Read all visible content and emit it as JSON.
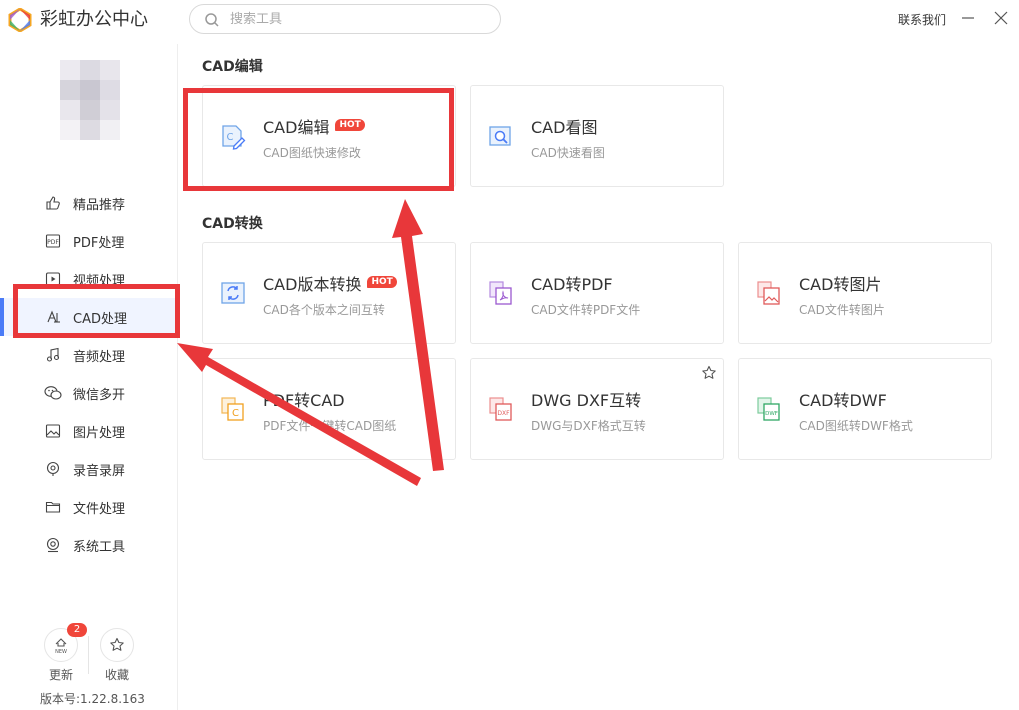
{
  "app": {
    "title": "彩虹办公中心",
    "contact_label": "联系我们",
    "search_placeholder": "搜索工具"
  },
  "sidebar": {
    "items": [
      {
        "label": "精品推荐",
        "icon": "thumbs-up-icon"
      },
      {
        "label": "PDF处理",
        "icon": "pdf-icon"
      },
      {
        "label": "视频处理",
        "icon": "video-icon"
      },
      {
        "label": "CAD处理",
        "icon": "cad-icon",
        "active": true
      },
      {
        "label": "音频处理",
        "icon": "music-icon"
      },
      {
        "label": "微信多开",
        "icon": "wechat-icon"
      },
      {
        "label": "图片处理",
        "icon": "image-icon"
      },
      {
        "label": "录音录屏",
        "icon": "record-icon"
      },
      {
        "label": "文件处理",
        "icon": "folder-icon"
      },
      {
        "label": "系统工具",
        "icon": "system-tools-icon"
      }
    ],
    "update_label": "更新",
    "update_badge": "2",
    "favorites_label": "收藏",
    "version": "版本号:1.22.8.163"
  },
  "sections": [
    {
      "title": "CAD编辑",
      "cards": [
        {
          "title": "CAD编辑",
          "subtitle": "CAD图纸快速修改",
          "hot": true,
          "icon": "cad-edit-icon"
        },
        {
          "title": "CAD看图",
          "subtitle": "CAD快速看图",
          "hot": false,
          "icon": "cad-view-icon"
        }
      ]
    },
    {
      "title": "CAD转换",
      "cards": [
        {
          "title": "CAD版本转换",
          "subtitle": "CAD各个版本之间互转",
          "hot": true,
          "icon": "cad-version-convert-icon"
        },
        {
          "title": "CAD转PDF",
          "subtitle": "CAD文件转PDF文件",
          "hot": false,
          "icon": "cad-to-pdf-icon"
        },
        {
          "title": "CAD转图片",
          "subtitle": "CAD文件转图片",
          "hot": false,
          "icon": "cad-to-image-icon"
        },
        {
          "title": "PDF转CAD",
          "subtitle": "PDF文件一键转CAD图纸",
          "hot": false,
          "icon": "pdf-to-cad-icon"
        },
        {
          "title": "DWG DXF互转",
          "subtitle": "DWG与DXF格式互转",
          "hot": false,
          "icon": "dwg-dxf-icon",
          "star": true
        },
        {
          "title": "CAD转DWF",
          "subtitle": "CAD图纸转DWF格式",
          "hot": false,
          "icon": "cad-to-dwf-icon"
        }
      ]
    }
  ],
  "hot_label": "HOT",
  "annotation_color": "#e8373a",
  "accent_color": "#4a7bf7"
}
